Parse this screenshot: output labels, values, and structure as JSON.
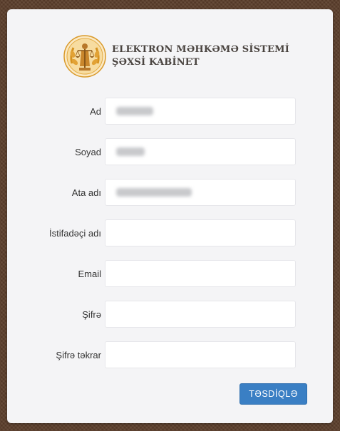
{
  "header": {
    "title_line1": "ELEKTRON MƏHKƏMƏ SİSTEMİ",
    "title_line2": "ŞƏXSİ KABİNET",
    "emblem_icon": "court-justice-emblem-icon"
  },
  "form": {
    "fields": [
      {
        "label": "Ad",
        "value": ""
      },
      {
        "label": "Soyad",
        "value": ""
      },
      {
        "label": "Ata adı",
        "value": ""
      },
      {
        "label": "İstifadəçi adı",
        "value": ""
      },
      {
        "label": "Email",
        "value": ""
      },
      {
        "label": "Şifrə",
        "value": ""
      },
      {
        "label": "Şifrə təkrar",
        "value": ""
      }
    ],
    "submit_label": "TƏSDİQLƏ"
  },
  "colors": {
    "background": "#5c3f2c",
    "card": "#f4f4f6",
    "accent_button": "#3a7fc4",
    "emblem_gold": "#e0a030"
  }
}
